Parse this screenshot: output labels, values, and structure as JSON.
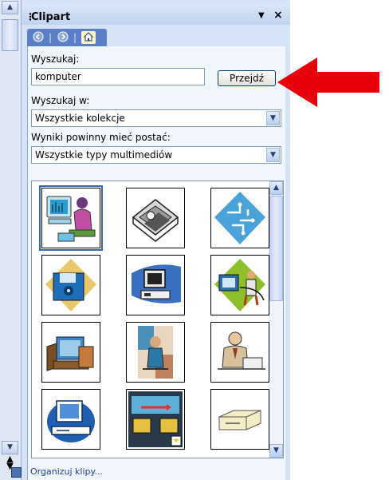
{
  "pane": {
    "title": "Clipart",
    "grip": "⋮",
    "menu_glyph": "▼",
    "close_glyph": "×"
  },
  "nav": {
    "back_icon": "back-arrow-icon",
    "forward_icon": "forward-arrow-icon",
    "home_icon": "home-icon",
    "separator": "|"
  },
  "search": {
    "label": "Wyszukaj:",
    "value": "komputer",
    "go_label": "Przejdź"
  },
  "search_in": {
    "label": "Wyszukaj w:",
    "value": "Wszystkie kolekcje"
  },
  "results_type": {
    "label": "Wyniki powinny mieć postać:",
    "value": "Wszystkie typy multimediów"
  },
  "results": {
    "items": [
      {
        "icon": "woman-at-computer-clipart",
        "selected": true
      },
      {
        "icon": "computer-disk-drive-clipart",
        "selected": false
      },
      {
        "icon": "circuit-board-clipart",
        "selected": false
      },
      {
        "icon": "floppy-disk-clipart",
        "selected": false
      },
      {
        "icon": "computer-terminal-clipart",
        "selected": false
      },
      {
        "icon": "man-at-computer-clipart",
        "selected": false
      },
      {
        "icon": "desktop-pc-clipart",
        "selected": false
      },
      {
        "icon": "person-collage-clipart",
        "selected": false
      },
      {
        "icon": "businessman-at-desk-clipart",
        "selected": false
      },
      {
        "icon": "blue-computer-clipart",
        "selected": false
      },
      {
        "icon": "network-computers-clipart",
        "selected": false
      },
      {
        "icon": "disk-drive-clipart",
        "selected": false
      }
    ]
  },
  "footer": {
    "organize_label": "Organizuj klipy..."
  },
  "colors": {
    "pane_bg": "#d6e3f7",
    "nav_bar": "#5b7fc6",
    "link": "#1e3fa8",
    "annotation_arrow": "#e8000b"
  }
}
